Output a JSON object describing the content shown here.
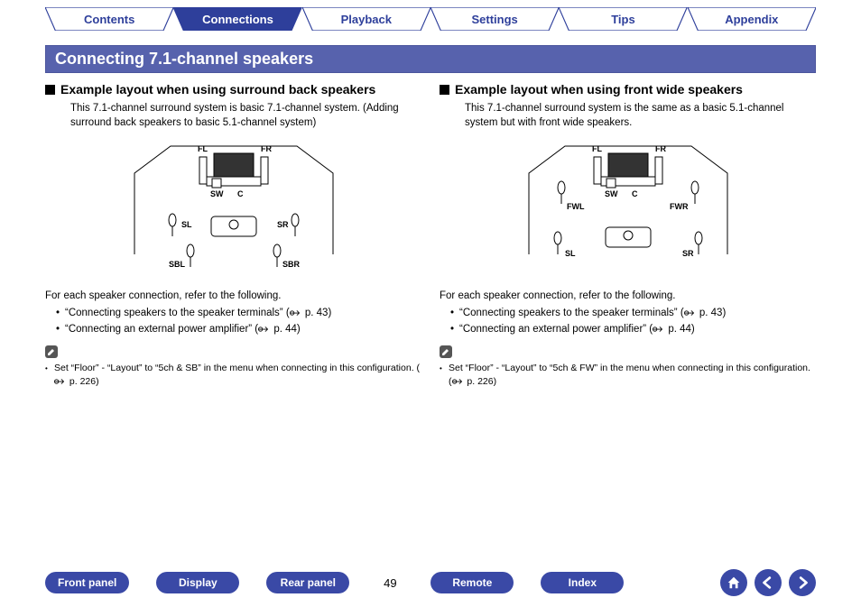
{
  "tabs": [
    {
      "label": "Contents",
      "active": false
    },
    {
      "label": "Connections",
      "active": true
    },
    {
      "label": "Playback",
      "active": false
    },
    {
      "label": "Settings",
      "active": false
    },
    {
      "label": "Tips",
      "active": false
    },
    {
      "label": "Appendix",
      "active": false
    }
  ],
  "section_title": "Connecting 7.1-channel speakers",
  "columns": {
    "left": {
      "heading": "Example layout when using surround back speakers",
      "description": "This 7.1-channel surround system is basic 7.1-channel system. (Adding surround back speakers to basic 5.1-channel system)",
      "diagram_labels": [
        "FL",
        "FR",
        "SW",
        "C",
        "SL",
        "SR",
        "SBL",
        "SBR"
      ],
      "follow_text": "For each speaker connection, refer to the following.",
      "refs": [
        {
          "text": "“Connecting speakers to the speaker terminals” (",
          "page": "p. 43",
          "suffix": ")"
        },
        {
          "text": "“Connecting an external power amplifier” (",
          "page": "p. 44",
          "suffix": ")"
        }
      ],
      "note": "Set “Floor” - “Layout” to “5ch & SB” in the menu when connecting in this configuration. (",
      "note_page": "p. 226",
      "note_suffix": ")"
    },
    "right": {
      "heading": "Example layout when using front wide speakers",
      "description": "This 7.1-channel surround system is the same as a basic 5.1-channel system but with front wide speakers.",
      "diagram_labels": [
        "FL",
        "FR",
        "SW",
        "C",
        "FWL",
        "FWR",
        "SL",
        "SR"
      ],
      "follow_text": "For each speaker connection, refer to the following.",
      "refs": [
        {
          "text": "“Connecting speakers to the speaker terminals” (",
          "page": "p. 43",
          "suffix": ")"
        },
        {
          "text": "“Connecting an external power amplifier” (",
          "page": "p. 44",
          "suffix": ")"
        }
      ],
      "note": "Set “Floor” - “Layout” to “5ch & FW” in the menu when connecting in this configuration. (",
      "note_page": "p. 226",
      "note_suffix": ")"
    }
  },
  "footer": {
    "buttons": [
      "Front panel",
      "Display",
      "Rear panel"
    ],
    "page": "49",
    "buttons2": [
      "Remote",
      "Index"
    ]
  }
}
